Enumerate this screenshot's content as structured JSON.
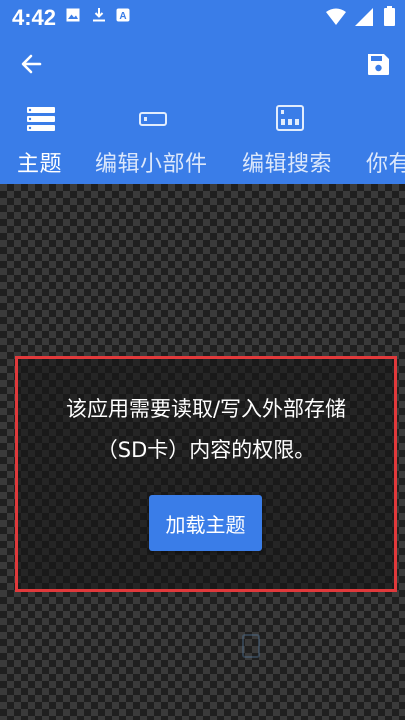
{
  "status_bar": {
    "time": "4:42",
    "notification_icons": [
      "image-icon",
      "download-icon",
      "a-badge-icon"
    ],
    "system_icons": [
      "wifi-icon",
      "signal-icon",
      "battery-icon"
    ]
  },
  "toolbar": {
    "back_icon": "arrow-left-icon",
    "save_icon": "save-icon"
  },
  "tabs": [
    {
      "label": "主题",
      "icon": "theme-list-icon",
      "selected": true
    },
    {
      "label": "编辑小部件",
      "icon": "widget-icon",
      "selected": false
    },
    {
      "label": "编辑搜索",
      "icon": "search-layout-icon",
      "selected": false
    },
    {
      "label": "你有",
      "icon": "",
      "selected": false
    }
  ],
  "permission": {
    "message_line1": "该应用需要读取/写入外部存储",
    "message_line2": "（SD卡）内容的权限。",
    "button_label": "加载主题"
  },
  "colors": {
    "primary": "#3a7de8",
    "highlight_border": "#e0393b",
    "checker_dark": "#1f1f1f",
    "checker_light": "#3a3a3a"
  }
}
